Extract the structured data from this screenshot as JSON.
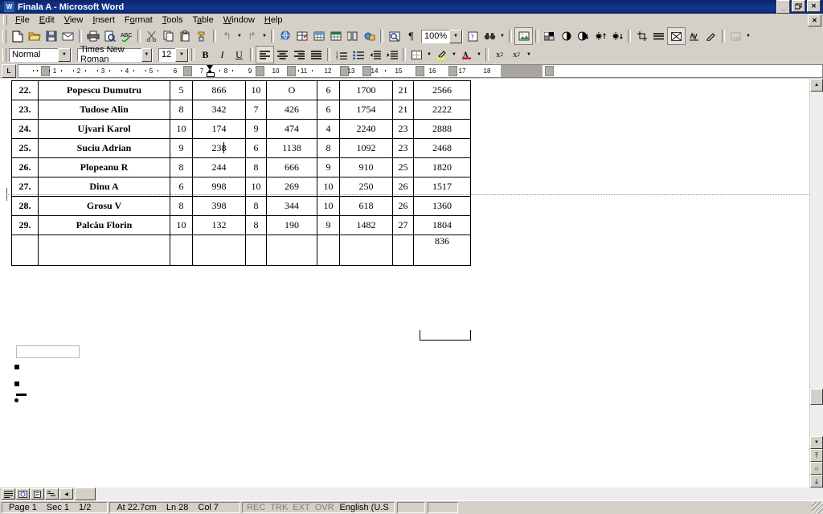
{
  "window": {
    "title": "Finala A - Microsoft Word",
    "app_icon": "word-document-icon",
    "minimize_label": "_",
    "restore_label": "❐",
    "close_label": "✕",
    "document_close_label": "✕"
  },
  "menu": {
    "items": [
      {
        "label": "File",
        "accel": "F"
      },
      {
        "label": "Edit",
        "accel": "E"
      },
      {
        "label": "View",
        "accel": "V"
      },
      {
        "label": "Insert",
        "accel": "I"
      },
      {
        "label": "Format",
        "accel": "o"
      },
      {
        "label": "Tools",
        "accel": "T"
      },
      {
        "label": "Table",
        "accel": "a"
      },
      {
        "label": "Window",
        "accel": "W"
      },
      {
        "label": "Help",
        "accel": "H"
      }
    ]
  },
  "standard_toolbar": {
    "buttons": [
      {
        "name": "new-document-icon",
        "glyph": "὜B"
      },
      {
        "name": "open-folder-icon",
        "glyph": "Ὄ2"
      },
      {
        "name": "save-icon",
        "glyph": "ὋE"
      },
      {
        "name": "mail-recipient-icon",
        "glyph": "✉"
      },
      {
        "name": "print-icon",
        "glyph": "὚8"
      },
      {
        "name": "print-preview-icon",
        "glyph": "ὐD"
      },
      {
        "name": "spelling-grammar-icon",
        "glyph": "ABC"
      },
      {
        "name": "cut-scissors-icon",
        "glyph": "✂"
      },
      {
        "name": "copy-icon",
        "glyph": "ὌB"
      },
      {
        "name": "paste-icon",
        "glyph": "ὌB"
      },
      {
        "name": "format-painter-icon",
        "glyph": "὘C"
      },
      {
        "name": "undo-icon",
        "glyph": "↶"
      },
      {
        "name": "redo-icon",
        "glyph": "↷"
      },
      {
        "name": "insert-hyperlink-icon",
        "glyph": "ἱ0"
      },
      {
        "name": "tables-and-borders-icon",
        "glyph": "⊞"
      },
      {
        "name": "insert-table-icon",
        "glyph": "▦"
      },
      {
        "name": "insert-excel-spreadsheet-icon",
        "glyph": "Ὄ8"
      },
      {
        "name": "columns-icon",
        "glyph": "‖"
      },
      {
        "name": "drawing-icon",
        "glyph": "✎"
      },
      {
        "name": "document-map-icon",
        "glyph": "ὟA"
      },
      {
        "name": "show-formatting-marks-icon",
        "glyph": "¶"
      },
      {
        "name": "office-assistant-icon",
        "glyph": "?"
      },
      {
        "name": "binoculars-icon",
        "glyph": "ὐE"
      }
    ],
    "zoom": {
      "value": "100%",
      "name": "zoom-combo"
    }
  },
  "formatting_toolbar": {
    "style": {
      "value": "Normal",
      "name": "style-combo"
    },
    "font": {
      "value": "Times New Roman",
      "name": "font-combo"
    },
    "size": {
      "value": "12",
      "name": "font-size-combo"
    },
    "bold_label": "B",
    "italic_label": "I",
    "underline_label": "U",
    "buttons": [
      {
        "name": "align-left-icon"
      },
      {
        "name": "align-center-icon"
      },
      {
        "name": "align-right-icon"
      },
      {
        "name": "justify-icon"
      },
      {
        "name": "numbered-list-icon"
      },
      {
        "name": "bulleted-list-icon"
      },
      {
        "name": "decrease-indent-icon"
      },
      {
        "name": "increase-indent-icon"
      },
      {
        "name": "borders-icon"
      },
      {
        "name": "highlight-icon"
      },
      {
        "name": "font-color-icon"
      },
      {
        "name": "superscript-icon"
      },
      {
        "name": "subscript-icon"
      }
    ]
  },
  "picture_toolbar": {
    "buttons": [
      {
        "name": "insert-picture-icon"
      },
      {
        "name": "image-control-icon"
      },
      {
        "name": "more-contrast-icon"
      },
      {
        "name": "less-contrast-icon"
      },
      {
        "name": "more-brightness-icon"
      },
      {
        "name": "less-brightness-icon"
      },
      {
        "name": "crop-icon"
      },
      {
        "name": "line-style-icon"
      },
      {
        "name": "text-wrapping-icon"
      },
      {
        "name": "format-picture-icon"
      },
      {
        "name": "set-transparent-color-icon"
      },
      {
        "name": "reset-picture-icon"
      }
    ]
  },
  "ruler": {
    "tab_selector_glyph": "L",
    "ticks": [
      "1",
      "2",
      "3",
      "4",
      "5",
      "6",
      "7",
      "8",
      "9",
      "10",
      "11",
      "12",
      "13",
      "14",
      "15",
      "16",
      "17",
      "18"
    ]
  },
  "document": {
    "table": {
      "rows": [
        {
          "no": "22.",
          "name": "Popescu Dumutru",
          "a": "5",
          "b": "866",
          "c": "10",
          "d": "O",
          "e": "6",
          "f": "1700",
          "g": "21",
          "h": "2566"
        },
        {
          "no": "23.",
          "name": "Tudose Alin",
          "a": "8",
          "b": "342",
          "c": "7",
          "d": "426",
          "e": "6",
          "f": "1754",
          "g": "21",
          "h": "2222"
        },
        {
          "no": "24.",
          "name": "Ujvari Karol",
          "a": "10",
          "b": "174",
          "c": "9",
          "d": "474",
          "e": "4",
          "f": "2240",
          "g": "23",
          "h": "2888"
        },
        {
          "no": "25.",
          "name": "Suciu Adrian",
          "a": "9",
          "b": "238",
          "c": "6",
          "d": "1138",
          "e": "8",
          "f": "1092",
          "g": "23",
          "h": "2468"
        },
        {
          "no": "26.",
          "name": "Plopeanu R",
          "a": "8",
          "b": "244",
          "c": "8",
          "d": "666",
          "e": "9",
          "f": "910",
          "g": "25",
          "h": "1820"
        },
        {
          "no": "27.",
          "name": "Dinu A",
          "a": "6",
          "b": "998",
          "c": "10",
          "d": "269",
          "e": "10",
          "f": "250",
          "g": "26",
          "h": "1517"
        },
        {
          "no": "28.",
          "name": "Grosu V",
          "a": "8",
          "b": "398",
          "c": "8",
          "d": "344",
          "e": "10",
          "f": "618",
          "g": "26",
          "h": "1360"
        },
        {
          "no": "29.",
          "name": "Palcău Florin",
          "a": "10",
          "b": "132",
          "c": "8",
          "d": "190",
          "e": "9",
          "f": "1482",
          "g": "27",
          "h": "1804"
        }
      ],
      "footer_row": {
        "no": "",
        "name": "",
        "a": "",
        "b": "",
        "c": "",
        "d": "",
        "e": "",
        "f": "",
        "g": "",
        "h": "836"
      },
      "cursor_in_cell": {
        "row_index": 3,
        "column": "b"
      }
    },
    "bullets": [
      "",
      "",
      ""
    ]
  },
  "statusbar": {
    "page": "Page  1",
    "section": "Sec  1",
    "pages": "1/2",
    "at": "At  22.7cm",
    "line": "Ln  28",
    "column": "Col  7",
    "rec": "REC",
    "trk": "TRK",
    "ext": "EXT",
    "ovr": "OVR",
    "language": "English (U.S"
  },
  "view_buttons": [
    {
      "name": "normal-view-button"
    },
    {
      "name": "web-layout-view-button"
    },
    {
      "name": "print-layout-view-button"
    },
    {
      "name": "outline-view-button"
    },
    {
      "name": "scroll-left-button"
    }
  ],
  "scrollbar": {
    "up_arrow": "▲",
    "down_arrow": "▼",
    "prev_page": "⤒",
    "select_browse": "○",
    "next_page": "⤓"
  }
}
